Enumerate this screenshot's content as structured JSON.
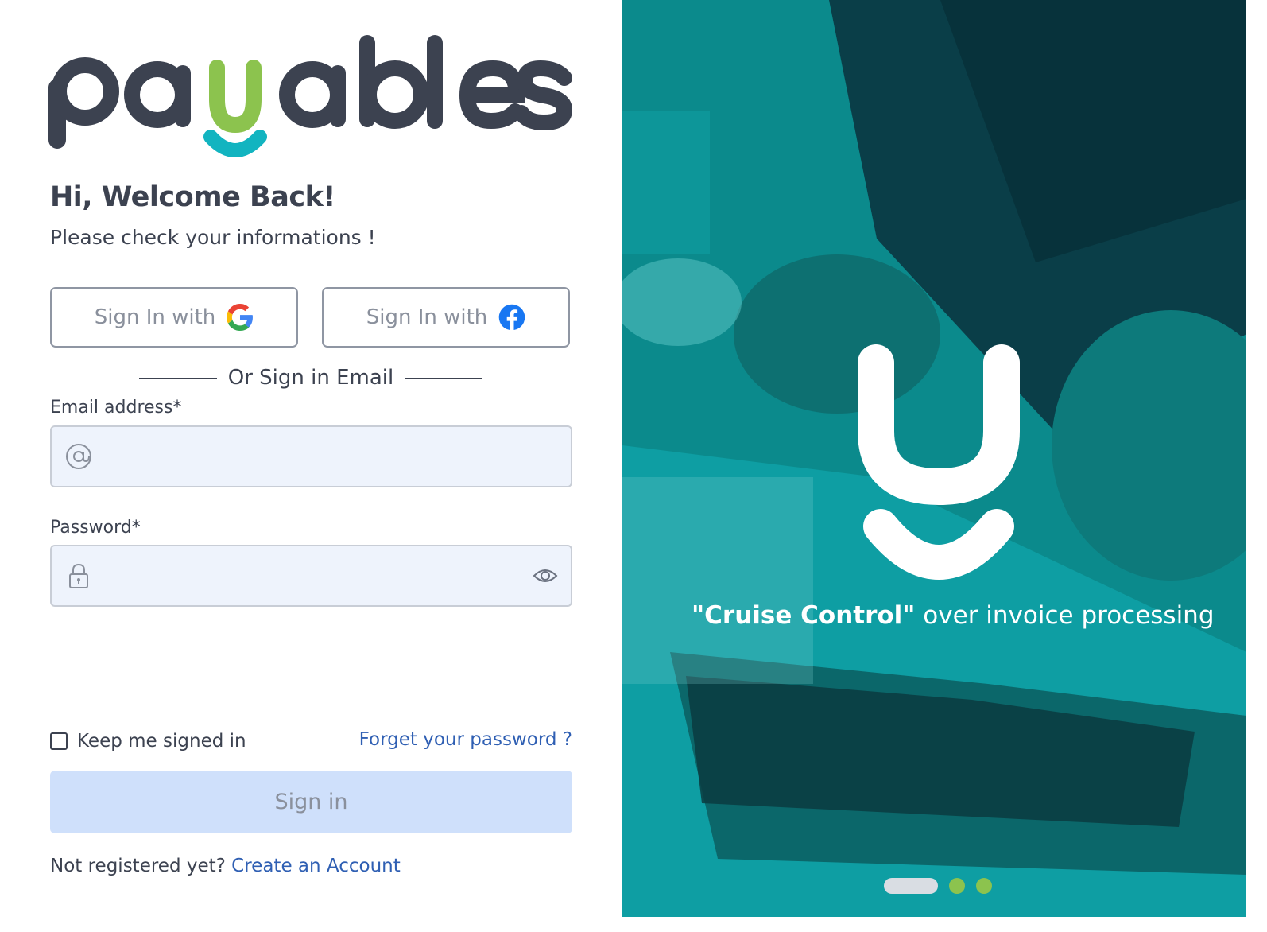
{
  "brand": {
    "name": "payables",
    "colors": {
      "dark": "#3c4250",
      "green": "#8cc34e",
      "teal": "#12b4c0",
      "link": "#2f5fb3"
    }
  },
  "welcome": {
    "title": "Hi, Welcome Back!",
    "subtitle": "Please check your informations !"
  },
  "social": {
    "google_label": "Sign In with",
    "facebook_label": "Sign In with",
    "google_icon": "google-icon",
    "facebook_icon": "facebook-icon"
  },
  "divider": {
    "text": "Or Sign in Email"
  },
  "form": {
    "email_label": "Email address*",
    "email_value": "",
    "email_icon": "at-sign-icon",
    "password_label": "Password*",
    "password_value": "",
    "password_icon": "lock-icon",
    "reveal_icon": "eye-icon",
    "remember_label": "Keep me signed in",
    "remember_checked": false,
    "forgot_label": "Forget your password ?",
    "submit_label": "Sign in"
  },
  "register": {
    "question": "Not registered yet?",
    "link_label": "Create an Account"
  },
  "hero": {
    "tagline_bold": "\"Cruise Control\"",
    "tagline_rest": " over invoice processing",
    "carousel": {
      "total": 3,
      "active": 1
    }
  }
}
